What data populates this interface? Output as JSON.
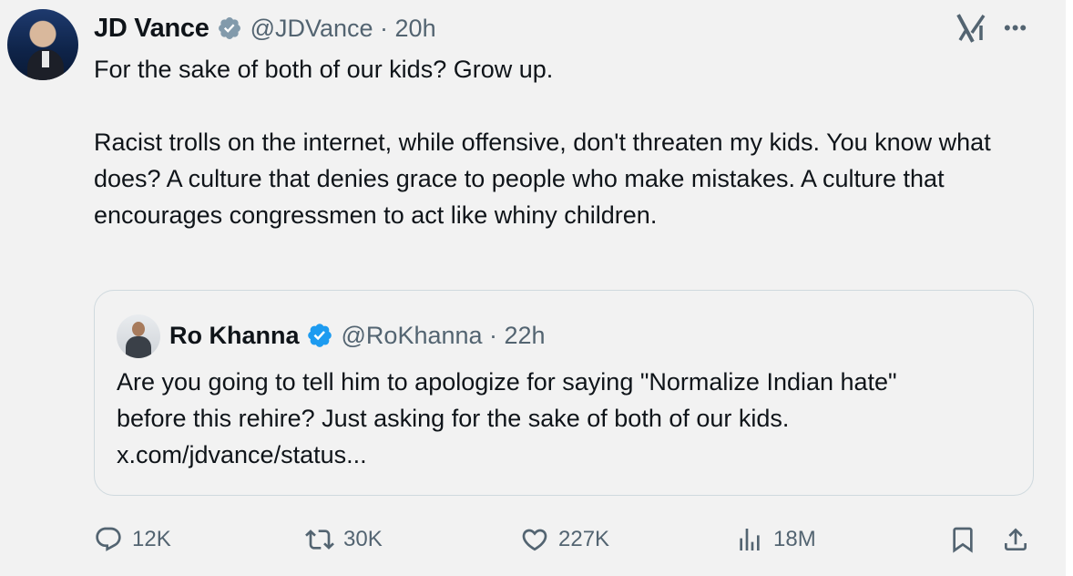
{
  "tweet": {
    "author_name": "JD Vance",
    "handle_time": "@JDVance · 20h",
    "paragraphs": [
      "For the sake of both of our kids? Grow up.",
      "Racist trolls on the internet, while offensive, don't threaten my kids. You know what does? A culture that denies grace to people who make mistakes. A culture that encourages congressmen to act like whiny children."
    ]
  },
  "quote": {
    "author_name": "Ro Khanna",
    "handle_time": "@RoKhanna · 22h",
    "lines": [
      "Are you going to tell him to apologize for saying \"Normalize Indian hate\"",
      "before this rehire? Just asking for the sake of both of our kids.",
      "x.com/jdvance/status..."
    ]
  },
  "actions": {
    "replies": "12K",
    "reposts": "30K",
    "likes": "227K",
    "views": "18M"
  },
  "icons": {
    "verified_gray": "verified-icon",
    "verified_blue": "verified-icon",
    "grok": "grok-icon",
    "more": "more-icon",
    "reply": "reply-icon",
    "repost": "repost-icon",
    "like": "heart-icon",
    "views": "views-icon",
    "bookmark": "bookmark-icon",
    "share": "share-icon"
  },
  "colors": {
    "verified_gray": "#829aab",
    "verified_blue": "#1d9bf0",
    "muted": "#536471"
  }
}
